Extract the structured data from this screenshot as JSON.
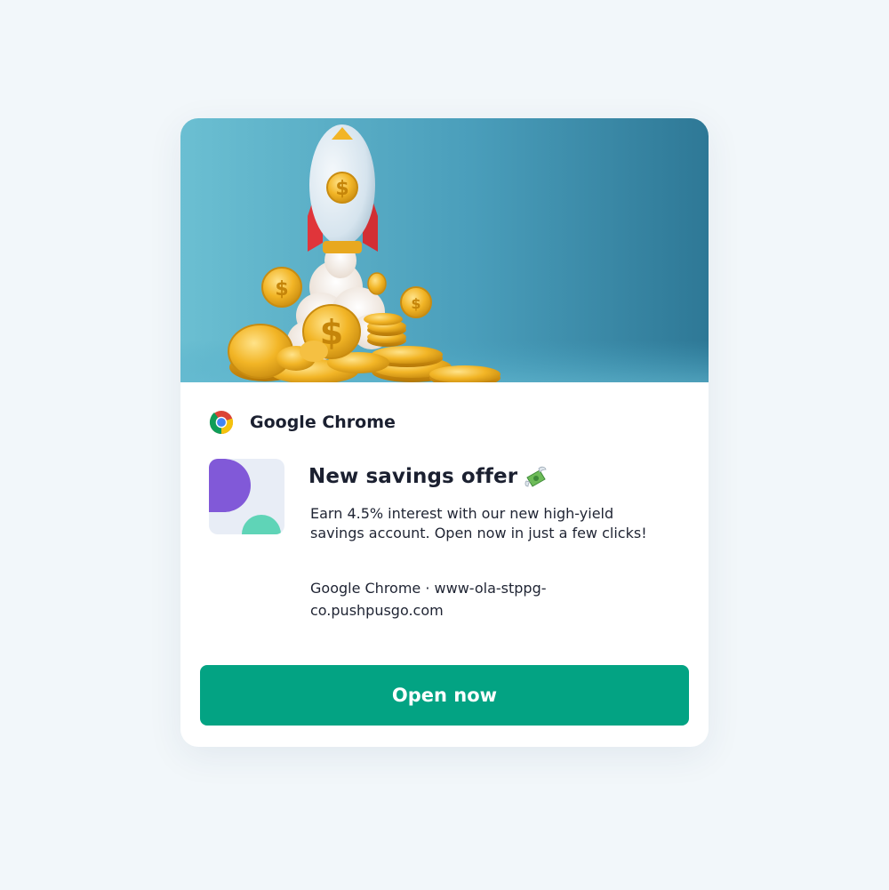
{
  "notification": {
    "source_name": "Google Chrome",
    "title": "New savings offer",
    "title_emoji_icon": "money-with-wings-icon",
    "body": "Earn 4.5% interest with our new high-yield savings account. Open now in just a few clicks!",
    "meta": "Google Chrome · www-ola-stppg-co.pushpusgo.com",
    "hero_image": "rocket-with-gold-coins-illustration",
    "app_icon": "abstract-purple-teal-shapes-icon",
    "browser_icon": "chrome-logo-icon"
  },
  "actions": {
    "open_label": "Open now"
  },
  "colors": {
    "page_background": "#f2f7fa",
    "card_background": "#ffffff",
    "button": "#03a383",
    "title_text": "#1b2030",
    "hero_sky_start": "#6bbfd2",
    "hero_sky_end": "#2e7896",
    "app_icon_purple": "#8159d8",
    "app_icon_teal": "#5fd4b7"
  }
}
